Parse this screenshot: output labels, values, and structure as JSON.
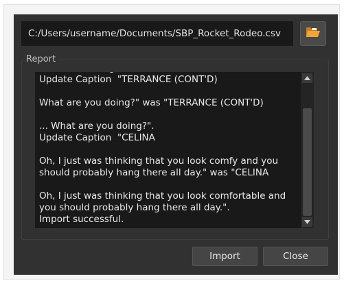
{
  "file_path": "C:/Users/username/Documents/SBP_Rocket_Rodeo.csv",
  "icons": {
    "browse": "folder-open-icon",
    "scroll_up": "arrow-up-icon",
    "scroll_down": "arrow-down-icon"
  },
  "report": {
    "label": "Report",
    "text": "Are we hovering?\".\nUpdate Caption  \"TERRANCE (CONT'D)\n\nWhat are you doing?\" was \"TERRANCE (CONT'D)\n\n... What are you doing?\".\nUpdate Caption  \"CELINA\n\nOh, I just was thinking that you look comfy and you should probably hang there all day.\" was \"CELINA\n\nOh, I just was thinking that you look comfortable and you should probably hang there all day.\".\nImport successful.",
    "scroll_position": 1.0,
    "visible_fraction": 0.82
  },
  "buttons": {
    "import_label": "Import",
    "close_label": "Close"
  },
  "colors": {
    "dialog_bg": "#313131",
    "field_bg": "#191919",
    "folder_icon": "#f2a53a",
    "text": "#e9e9e9"
  }
}
